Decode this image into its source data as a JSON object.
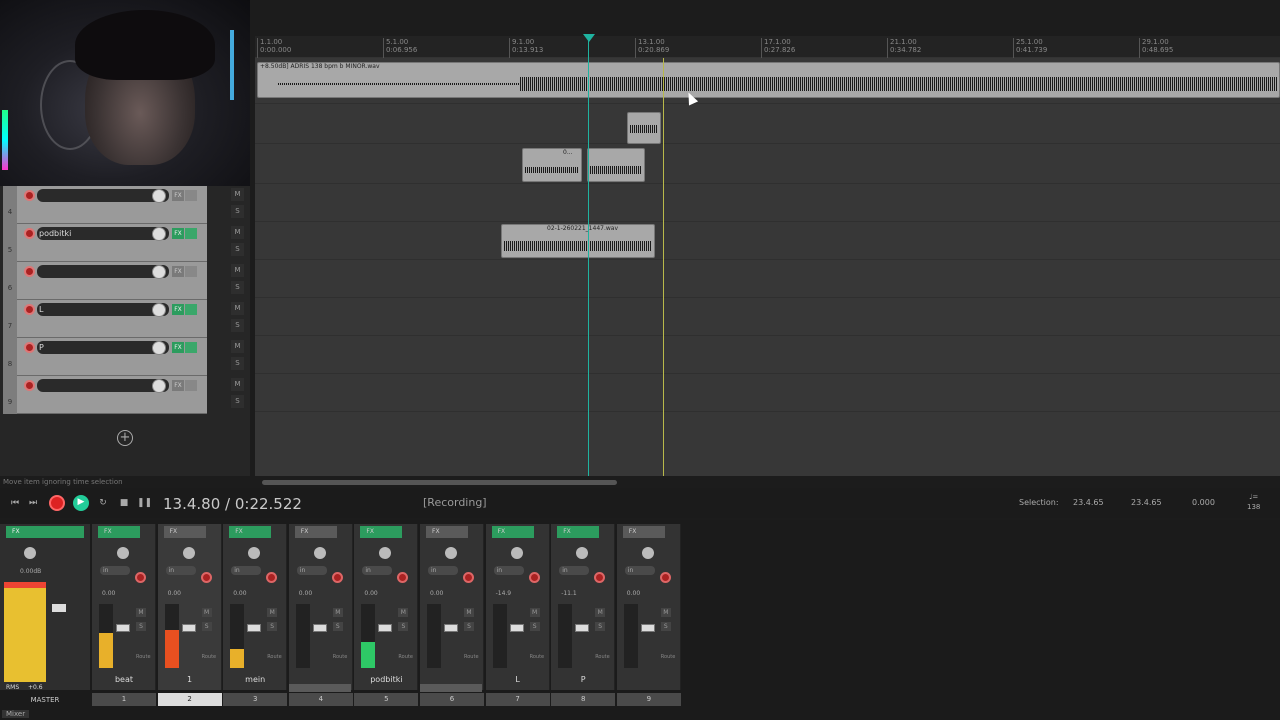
{
  "ruler": {
    "ticks": [
      {
        "bar": "1.1.00",
        "time": "0:00.000"
      },
      {
        "bar": "5.1.00",
        "time": "0:06.956"
      },
      {
        "bar": "9.1.00",
        "time": "0:13.913"
      },
      {
        "bar": "13.1.00",
        "time": "0:20.869"
      },
      {
        "bar": "17.1.00",
        "time": "0:27.826"
      },
      {
        "bar": "21.1.00",
        "time": "0:34.782"
      },
      {
        "bar": "25.1.00",
        "time": "0:41.739"
      },
      {
        "bar": "29.1.00",
        "time": "0:48.695"
      }
    ]
  },
  "items": {
    "beat_item": "+8.50dB] ADRIS 138 bpm b MINOR.wav",
    "vocal_a": "0...",
    "vocal_b": "02-1-260221_1447.wav"
  },
  "tracks": [
    {
      "num": "4",
      "name": "",
      "fx_on": false
    },
    {
      "num": "5",
      "name": "podbitki",
      "fx_on": true
    },
    {
      "num": "6",
      "name": "",
      "fx_on": false
    },
    {
      "num": "7",
      "name": "L",
      "fx_on": true
    },
    {
      "num": "8",
      "name": "P",
      "fx_on": true
    },
    {
      "num": "9",
      "name": "",
      "fx_on": false
    }
  ],
  "hint": "Move item ignoring time selection",
  "transport": {
    "time": "13.4.80 / 0:22.522",
    "status": "[Recording]",
    "selection_label": "Selection:",
    "sel_start": "23.4.65",
    "sel_end": "23.4.65",
    "sel_len": "0.000",
    "tempo_icon": "♩=",
    "tempo": "138"
  },
  "mixer": {
    "master_label": "MASTER",
    "master_peak": "0.00dB",
    "master_rms": "RMS",
    "master_rms_val": "+0.6",
    "tab": "Mixer",
    "strips": [
      {
        "name": "beat",
        "num": "1",
        "vol": "0.00",
        "meter": 0.55,
        "color": "#e8b02a",
        "fx_on": true
      },
      {
        "name": "1",
        "num": "2",
        "vol": "0.00",
        "meter": 0.6,
        "color": "#e85020",
        "fx_on": false,
        "selected": true
      },
      {
        "name": "mein",
        "num": "3",
        "vol": "0.00",
        "meter": 0.3,
        "color": "#e8b02a",
        "fx_on": true
      },
      {
        "name": "",
        "num": "4",
        "vol": "0.00",
        "meter": 0.0,
        "color": "#2ec866",
        "fx_on": false,
        "folder": true
      },
      {
        "name": "podbitki",
        "num": "5",
        "vol": "0.00",
        "meter": 0.4,
        "color": "#2ec866",
        "fx_on": true
      },
      {
        "name": "",
        "num": "6",
        "vol": "0.00",
        "meter": 0.0,
        "color": "#2ec866",
        "fx_on": false,
        "folder": true
      },
      {
        "name": "L",
        "num": "7",
        "vol": "-14.9",
        "meter": 0.0,
        "color": "#2ec866",
        "fx_on": true
      },
      {
        "name": "P",
        "num": "8",
        "vol": "-11.1",
        "meter": 0.0,
        "color": "#2ec866",
        "fx_on": true
      },
      {
        "name": "",
        "num": "9",
        "vol": "0.00",
        "meter": 0.0,
        "color": "#2ec866",
        "fx_on": false
      }
    ]
  },
  "labels": {
    "fx": "FX",
    "in": "in",
    "route": "Route",
    "m": "M",
    "s": "S",
    "add": "+"
  }
}
